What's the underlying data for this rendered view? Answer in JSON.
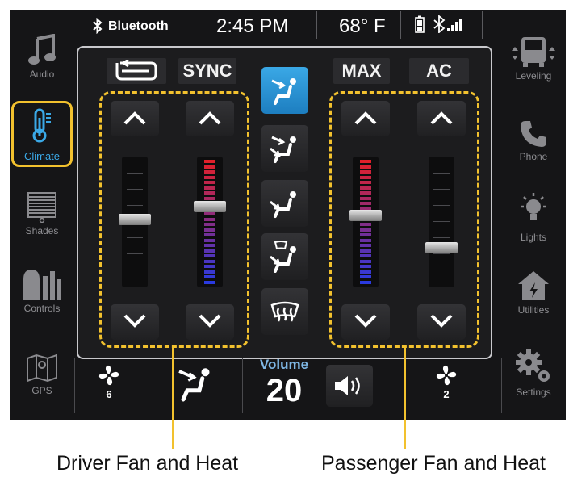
{
  "status_bar": {
    "bluetooth_label": "Bluetooth",
    "time": "2:45 PM",
    "temperature": "68° F"
  },
  "nav": {
    "audio": "Audio",
    "climate": "Climate",
    "shades": "Shades",
    "controls": "Controls",
    "gps": "GPS",
    "leveling": "Leveling",
    "phone": "Phone",
    "lights": "Lights",
    "utilities": "Utilities",
    "settings": "Settings"
  },
  "climate": {
    "recirculate_icon": "recirculate-icon",
    "sync_label": "SYNC",
    "max_label": "MAX",
    "ac_label": "AC",
    "active_vent_mode": "face",
    "vent_modes": [
      "face",
      "face-and-floor",
      "floor",
      "floor-and-defrost",
      "defrost"
    ],
    "driver": {
      "fan_level": 0.52,
      "heat_level": 0.62
    },
    "passenger": {
      "heat_level": 0.55,
      "fan_level": 0.3
    }
  },
  "bottom_bar": {
    "driver_fan_speed": "6",
    "volume_label": "Volume",
    "volume_value": "20",
    "passenger_fan_speed": "2"
  },
  "captions": {
    "driver": "Driver Fan and Heat",
    "passenger": "Passenger Fan and Heat"
  },
  "colors": {
    "accent_yellow": "#f2c12e",
    "active_blue": "#2a93d5",
    "heat_red": "#e0202a",
    "cool_blue": "#2a3ae0"
  }
}
